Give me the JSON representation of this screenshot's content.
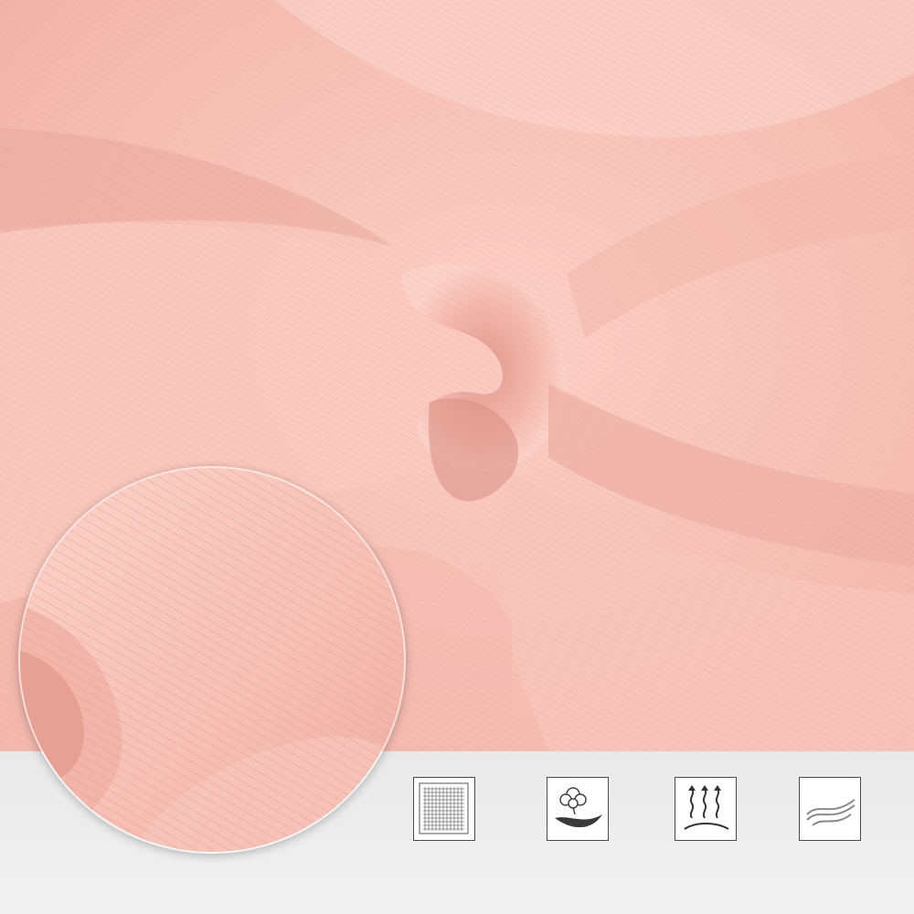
{
  "image": {
    "subject": "fabric-photo",
    "colors": {
      "fabric_base": "#f6bdb3",
      "fabric_light": "#fbd1c8",
      "fabric_shadow": "#e79d92",
      "background_band": "#ececec",
      "icon_border": "#4a4a4a"
    }
  },
  "features": [
    {
      "icon": "knit-grid-icon"
    },
    {
      "icon": "cotton-flower-icon"
    },
    {
      "icon": "breathable-heat-icon"
    },
    {
      "icon": "soft-wave-icon"
    }
  ]
}
